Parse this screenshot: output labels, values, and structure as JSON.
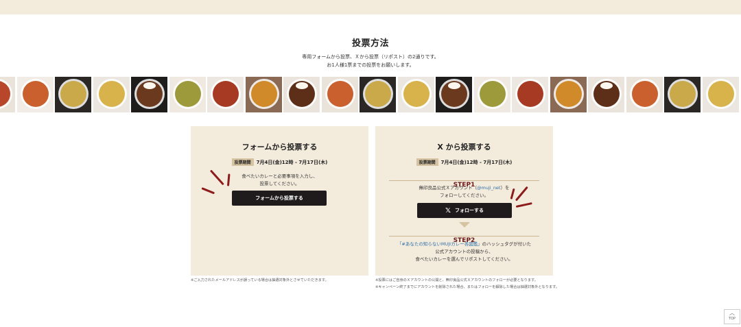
{
  "section": {
    "title": "投票方法",
    "intro_line1": "専用フォームから投票、Ｘから投票（リポスト）の2通りです。",
    "intro_line2": "お1人様1票までの投票をお願いします。"
  },
  "form_card": {
    "title": "フォームから投票する",
    "period_badge": "投票期間",
    "period_text": "7月4日(金)12時 - 7月17日(木)",
    "desc_line1": "食べたいカレーと必要事項を入力し、",
    "desc_line2": "投票してください。",
    "button_label": "フォームから投票する",
    "note": "※ご入力されたメールアドレスが誤っている場合は抽選対象外とさせていただきます。"
  },
  "x_card": {
    "title": "X から投票する",
    "period_badge": "投票期間",
    "period_text": "7月4日(金)12時 - 7月17日(木)",
    "step1_label": "STEP1",
    "step1_line1_pre": "無印良品公式Ｘアカウント（",
    "step1_handle": "@muji_net",
    "step1_line1_post": "）を",
    "step1_line2": "フォローしてください。",
    "follow_button_label": "フォローする",
    "follow_button_icon": "x-logo-icon",
    "step2_label": "STEP2",
    "step2_hashtag": "「#あなたの知らないMUJIカレー各図鑑」",
    "step2_line1_post": "のハッシュタグが付いた",
    "step2_line2": "公式アカウントの投稿から、",
    "step2_line3": "食べたいカレーを選んでリポストしてください。",
    "note_line1": "※投票にはご自身のＸアカウントの公開と、無印良品公式Ｘアカウントのフォローが必要となります。",
    "note_line2": "※キャンペーン終了までにアカウントを削除された場合、またはフォローを解除した場合は抽選対象外となります。"
  },
  "page_top": {
    "label": "TOP"
  },
  "colors": {
    "accent_red": "#8c1c1c",
    "card_bg": "#f3ebdc",
    "button_bg": "#1f1b1c"
  }
}
